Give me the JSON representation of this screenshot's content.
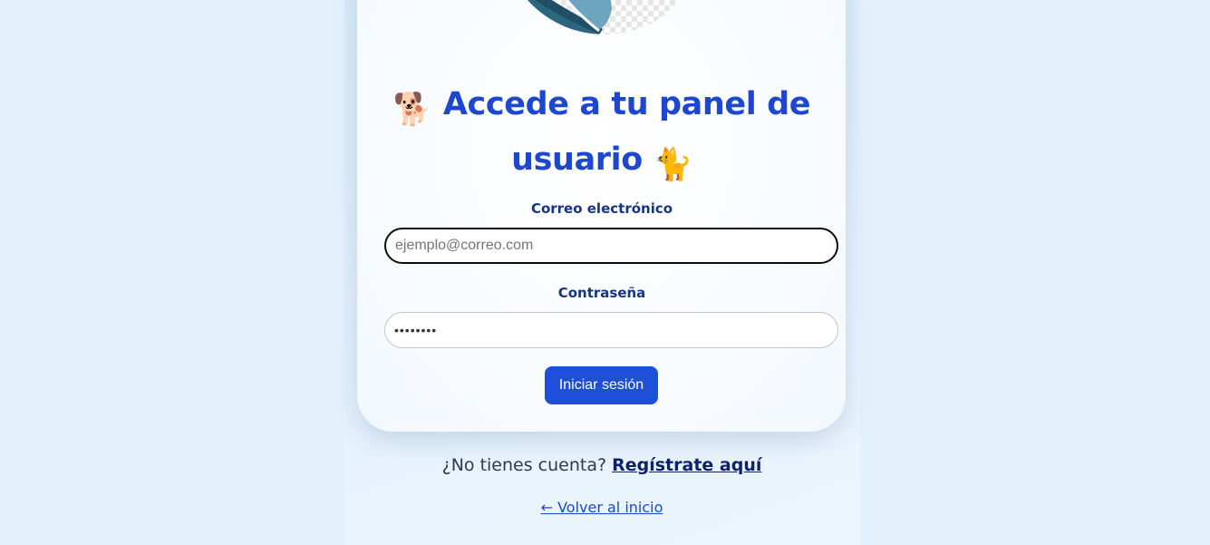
{
  "page": {
    "title_part1": "Accede a tu panel de",
    "title_part2": "usuario",
    "dog_emoji": "🐕",
    "cat_emoji": "🐈"
  },
  "form": {
    "email_label": "Correo electrónico",
    "email_placeholder": "ejemplo@correo.com",
    "password_label": "Contraseña",
    "password_value": "••••••••",
    "submit_label": "Iniciar sesión"
  },
  "footer": {
    "no_account_text": "¿No tienes cuenta?",
    "register_link": "Regístrate aquí",
    "back_link": "← Volver al inicio"
  },
  "colors": {
    "background": "#e2f1fc",
    "accent": "#1e4fd8",
    "title": "#1e47cf",
    "label": "#173480"
  },
  "icons": {
    "hero_image": "pet-illustration-partial",
    "dog": "dog-emoji-icon",
    "cat": "cat-emoji-icon"
  }
}
